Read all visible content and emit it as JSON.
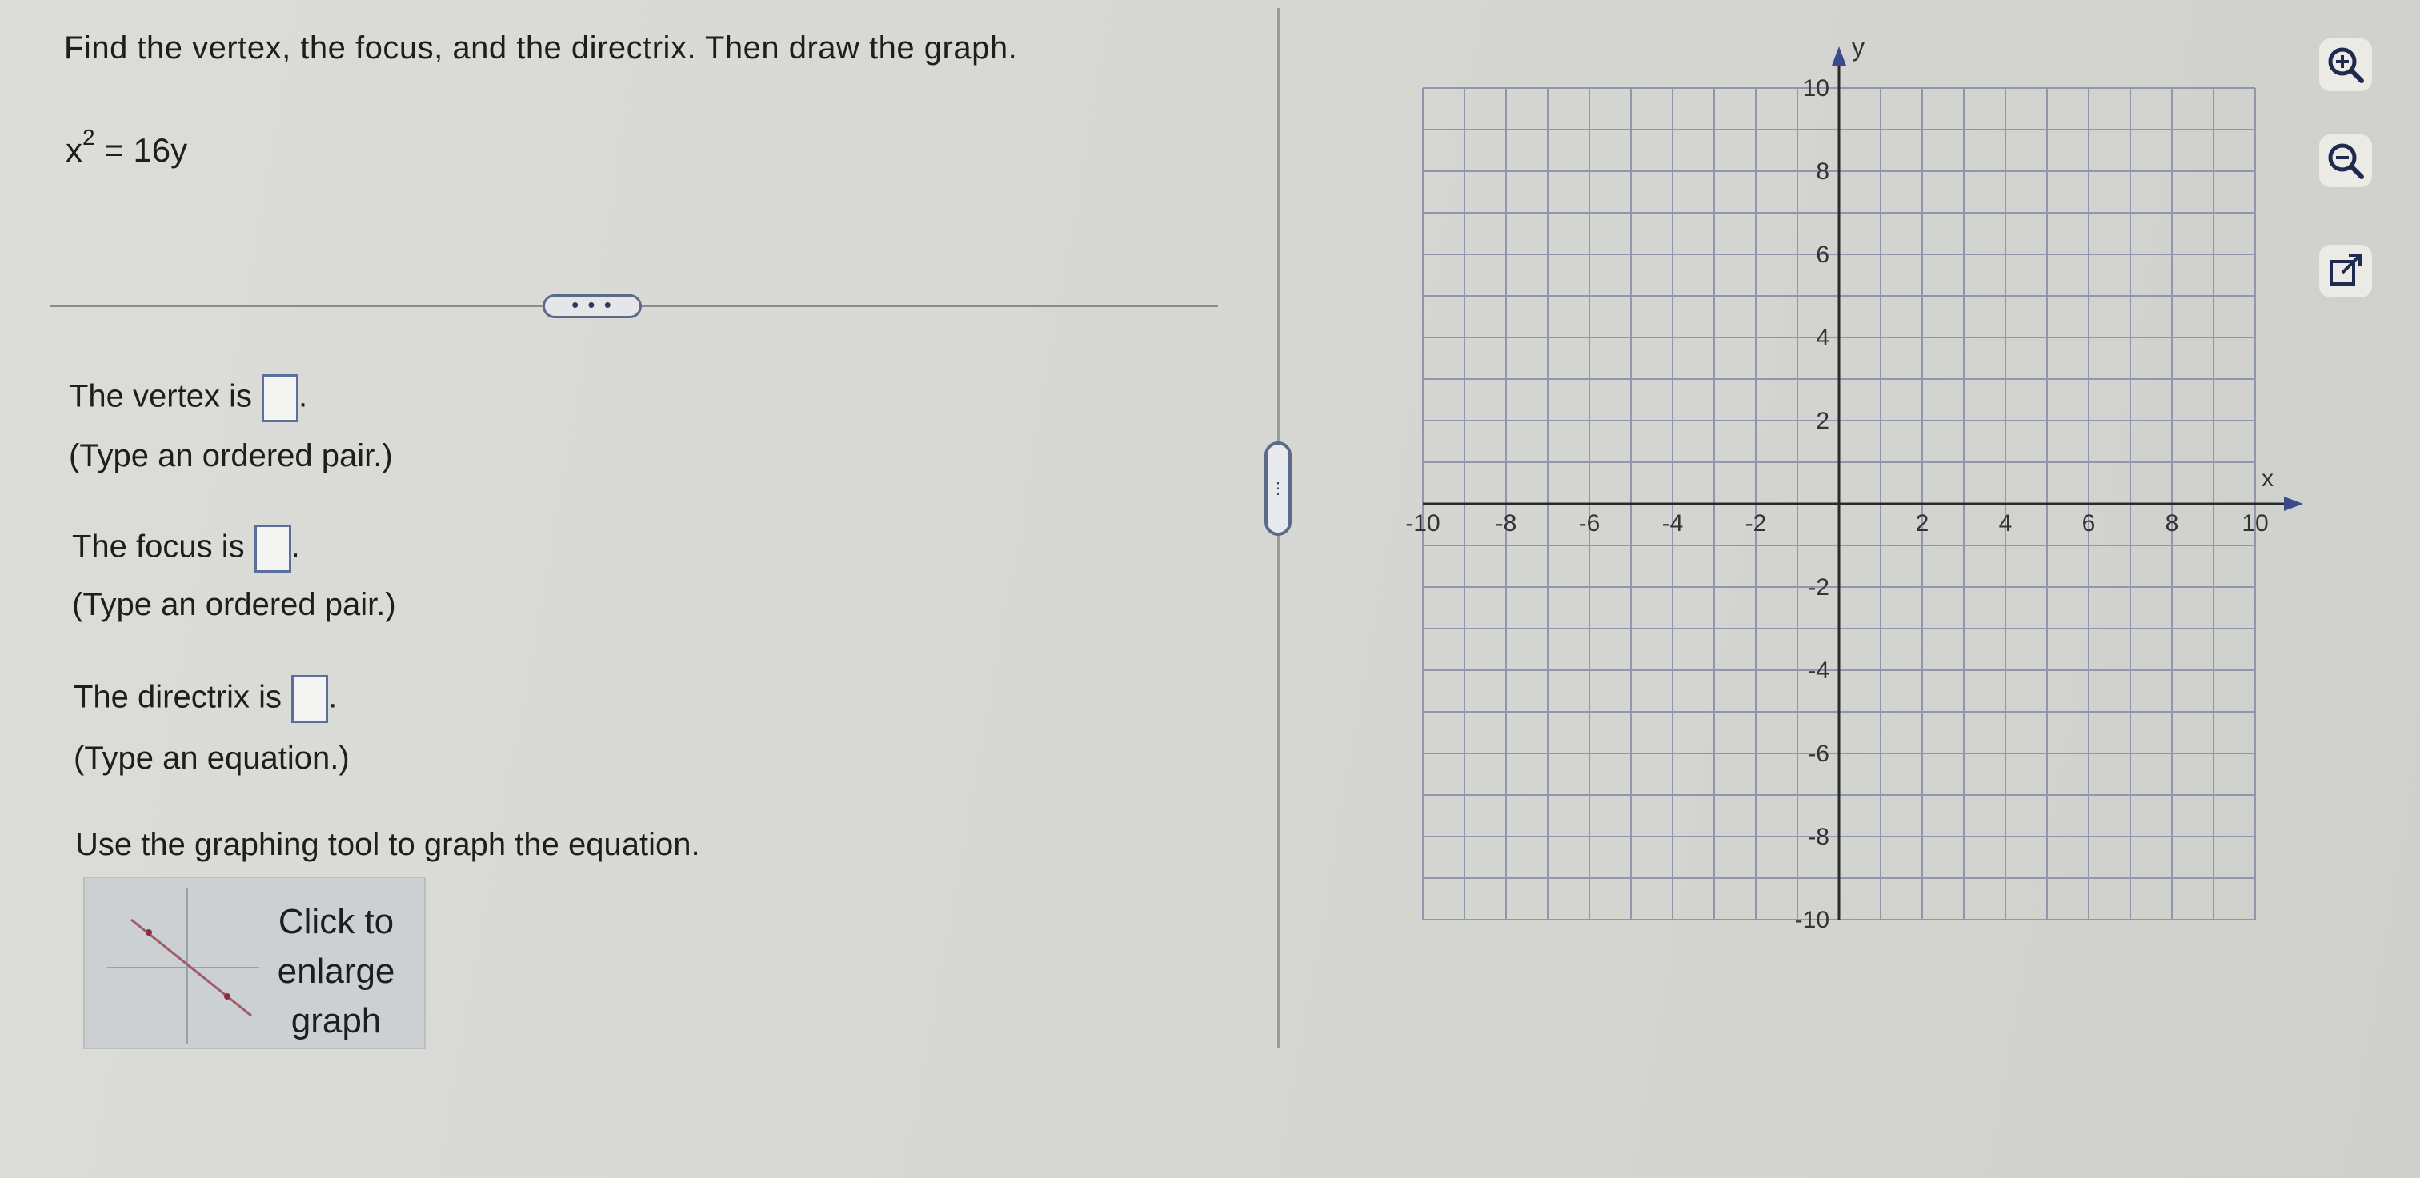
{
  "problem": {
    "instruction": "Find the vertex, the focus, and the directrix. Then draw the graph.",
    "equation_base": "x",
    "equation_exp": "2",
    "equation_rest": " = 16y"
  },
  "more_button": "• • •",
  "answers": {
    "vertex_label": "The vertex is",
    "vertex_hint": "(Type an ordered pair.)",
    "focus_label": "The focus is",
    "focus_hint": "(Type an ordered pair.)",
    "directrix_label": "The directrix is",
    "directrix_hint": "(Type an equation.)",
    "period": "."
  },
  "graph_instruction": "Use the graphing tool to graph the equation.",
  "thumbnail": {
    "line1": "Click to",
    "line2": "enlarge",
    "line3": "graph"
  },
  "splitter_glyph": "⋮",
  "graph": {
    "x_axis_label": "x",
    "y_axis_label": "y",
    "x_ticks": [
      "-10",
      "-8",
      "-6",
      "-4",
      "-2",
      "2",
      "4",
      "6",
      "8",
      "10"
    ],
    "y_ticks": [
      "10",
      "8",
      "6",
      "4",
      "2",
      "-2",
      "-4",
      "-6",
      "-8",
      "-10"
    ],
    "range": [
      -10,
      10
    ],
    "minor_step": 1,
    "grid_color": "#8e96b0"
  },
  "side_tools": [
    {
      "name": "zoom-in-icon"
    },
    {
      "name": "zoom-out-icon"
    },
    {
      "name": "open-external-icon"
    }
  ]
}
